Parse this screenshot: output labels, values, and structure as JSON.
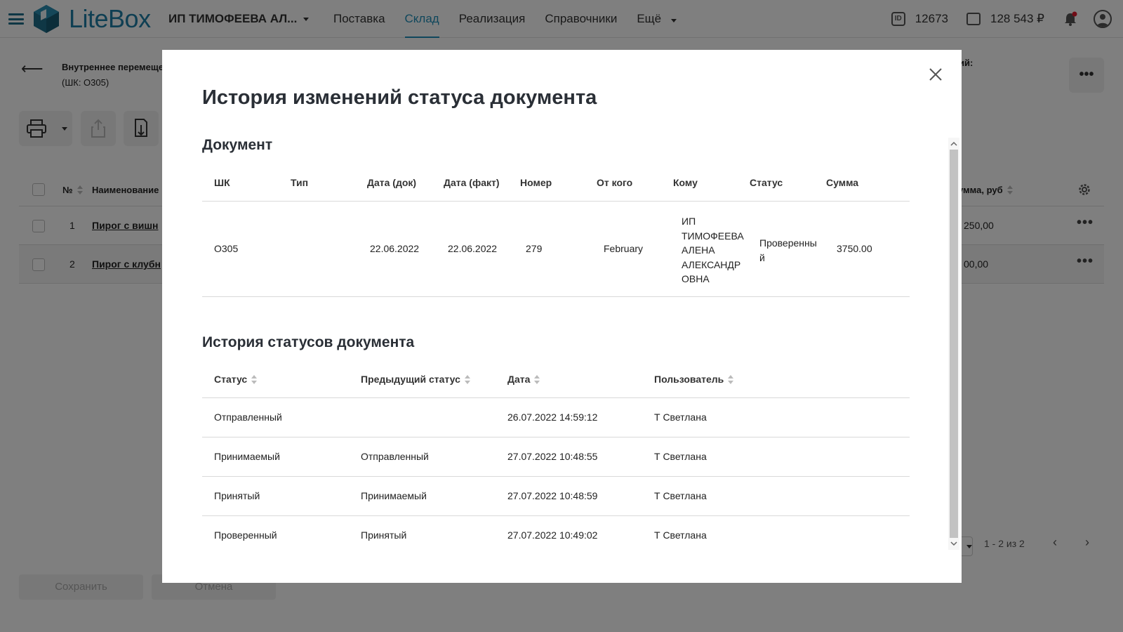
{
  "header": {
    "logo_text": "LiteBox",
    "org_name": "ИП ТИМОФЕЕВА АЛ...",
    "nav": [
      "Поставка",
      "Склад",
      "Реализация",
      "Справочники",
      "Ещё"
    ],
    "active_nav": "Склад",
    "id_value": "12673",
    "balance": "128 543 ₽",
    "id_badge": "ID"
  },
  "background": {
    "doc_title_line1": "Внутреннее перемеще",
    "doc_title_line2": "(ШК: О305)",
    "right_label": "ий:",
    "more_dots": "•••",
    "table_headers": {
      "num": "№",
      "name": "Наименование",
      "sum": "умма, руб"
    },
    "rows": [
      {
        "num": "1",
        "name": "Пирог с вишн",
        "sum": "250,00"
      },
      {
        "num": "2",
        "name": "Пирог с клубн",
        "sum": "00,00"
      }
    ],
    "pager_text": "1 - 2 из 2",
    "save_label": "Сохранить",
    "cancel_label": "Отмена"
  },
  "modal": {
    "title": "История изменений статуса документа",
    "document_section": "Документ",
    "document_headers": [
      "ШК",
      "Тип",
      "Дата (док)",
      "Дата (факт)",
      "Номер",
      "От кого",
      "Кому",
      "Статус",
      "Сумма"
    ],
    "document_row": {
      "shk": "О305",
      "type": "",
      "date_doc": "22.06.2022",
      "date_fact": "22.06.2022",
      "number": "279",
      "from": "February",
      "to_lines": [
        "ИП",
        "ТИМОФЕЕВА",
        "АЛЕНА",
        "АЛЕКСАНДР",
        "ОВНА"
      ],
      "status_lines": [
        "Проверенны",
        "й"
      ],
      "sum": "3750.00"
    },
    "history_section": "История статусов документа",
    "history_headers": [
      "Статус",
      "Предыдущий статус",
      "Дата",
      "Пользователь"
    ],
    "history_rows": [
      {
        "status": "Отправленный",
        "prev": "",
        "date": "26.07.2022 14:59:12",
        "user": "Т Светлана"
      },
      {
        "status": "Принимаемый",
        "prev": "Отправленный",
        "date": "27.07.2022 10:48:55",
        "user": "Т Светлана"
      },
      {
        "status": "Принятый",
        "prev": "Принимаемый",
        "date": "27.07.2022 10:48:59",
        "user": "Т Светлана"
      },
      {
        "status": "Проверенный",
        "prev": "Принятый",
        "date": "27.07.2022 10:49:02",
        "user": "Т Светлана"
      }
    ]
  },
  "colors": {
    "brand": "#1f7fa6",
    "accent": "#1f8fb8",
    "notification_dot": "#e0182d"
  }
}
